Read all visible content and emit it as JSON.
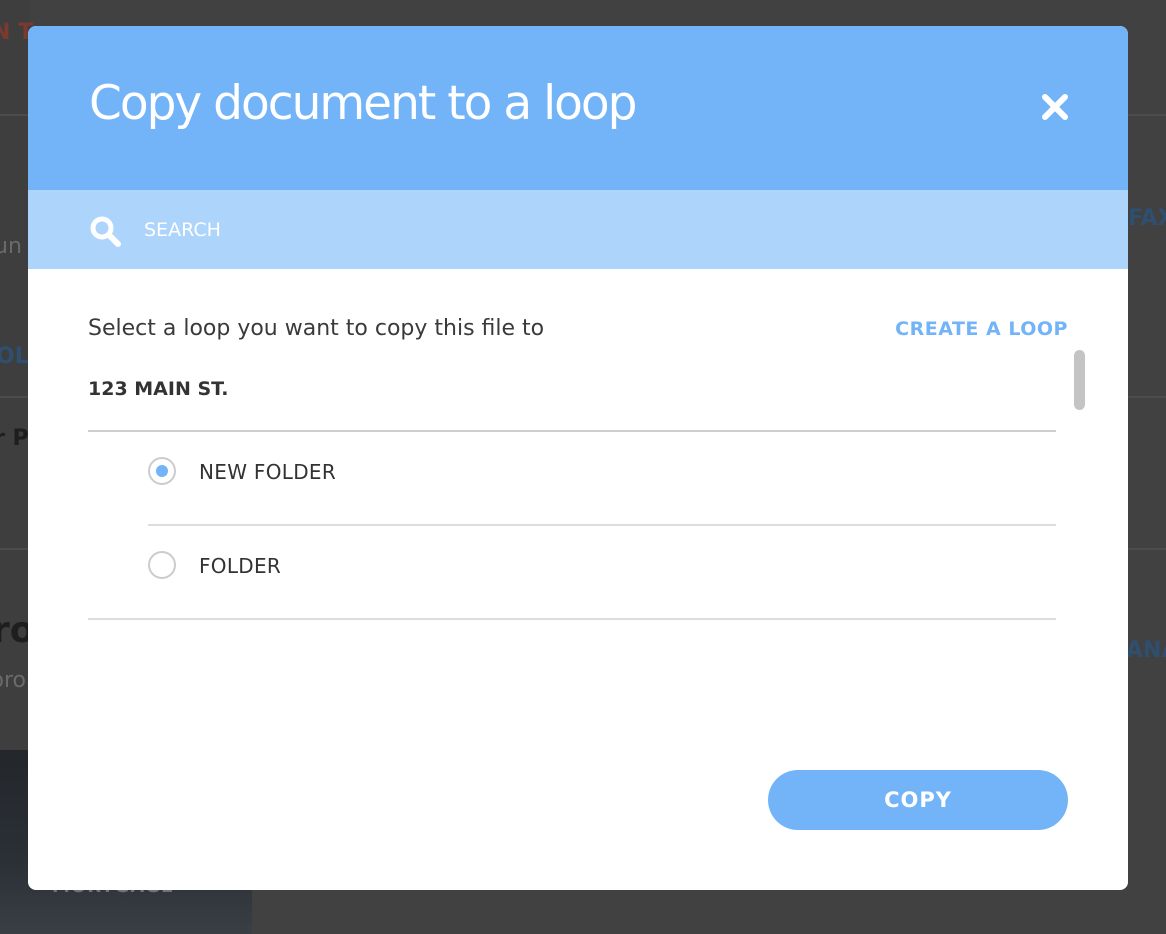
{
  "background": {
    "fragments": [
      "N T",
      "un",
      "OL",
      "r P",
      "FAX",
      "ro",
      "pro",
      "ANA",
      "MORTGAGE"
    ]
  },
  "modal": {
    "title": "Copy document to a loop",
    "close_icon": "close-icon",
    "search": {
      "placeholder": "SEARCH",
      "icon": "search-icon"
    },
    "instruction": "Select a loop you want to copy this file to",
    "create_loop_label": "CREATE A LOOP",
    "loop_name": "123 MAIN ST.",
    "folders": [
      {
        "label": "NEW FOLDER",
        "selected": true
      },
      {
        "label": "FOLDER",
        "selected": false
      }
    ],
    "copy_label": "COPY"
  },
  "colors": {
    "accent": "#72b4f7",
    "search_bar": "#add4fa",
    "overlay": "#414141"
  }
}
